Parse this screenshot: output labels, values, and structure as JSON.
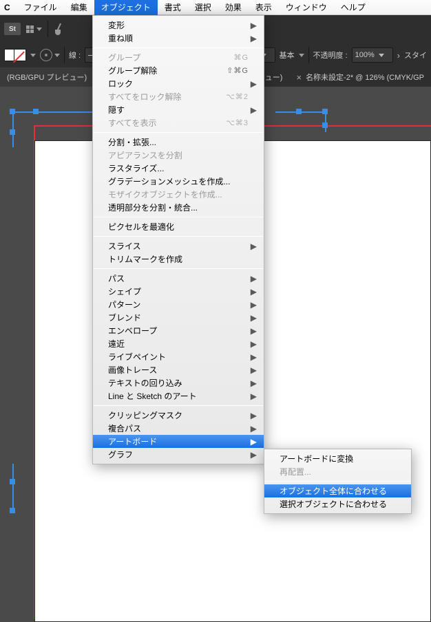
{
  "menubar": {
    "app": "C",
    "items": [
      "ファイル",
      "編集",
      "オブジェクト",
      "書式",
      "選択",
      "効果",
      "表示",
      "ウィンドウ",
      "ヘルプ"
    ],
    "active_index": 2
  },
  "toolbar": {
    "st_label": "St"
  },
  "propbar": {
    "stroke_label": "線 :",
    "basic_label": "基本",
    "opacity_label": "不透明度 :",
    "opacity_value": "100%",
    "style_label": "スタイ"
  },
  "tabs": {
    "t1": "(RGB/GPU プレビュー)",
    "t2_suffix": "ュー)",
    "t3": "名称未設定-2* @ 126% (CMYK/GP"
  },
  "menu": {
    "g1": [
      {
        "label": "変形",
        "sub": true
      },
      {
        "label": "重ね順",
        "sub": true
      }
    ],
    "g2": [
      {
        "label": "グループ",
        "sc": "⌘G",
        "disabled": true
      },
      {
        "label": "グループ解除",
        "sc": "⇧⌘G"
      },
      {
        "label": "ロック",
        "sub": true
      },
      {
        "label": "すべてをロック解除",
        "sc": "⌥⌘2",
        "disabled": true
      },
      {
        "label": "隠す",
        "sub": true
      },
      {
        "label": "すべてを表示",
        "sc": "⌥⌘3",
        "disabled": true
      }
    ],
    "g3": [
      {
        "label": "分割・拡張..."
      },
      {
        "label": "アピアランスを分割",
        "disabled": true
      },
      {
        "label": "ラスタライズ..."
      },
      {
        "label": "グラデーションメッシュを作成..."
      },
      {
        "label": "モザイクオブジェクトを作成...",
        "disabled": true
      },
      {
        "label": "透明部分を分割・統合..."
      }
    ],
    "g4": [
      {
        "label": "ピクセルを最適化"
      }
    ],
    "g5": [
      {
        "label": "スライス",
        "sub": true
      },
      {
        "label": "トリムマークを作成"
      }
    ],
    "g6": [
      {
        "label": "パス",
        "sub": true
      },
      {
        "label": "シェイプ",
        "sub": true
      },
      {
        "label": "パターン",
        "sub": true
      },
      {
        "label": "ブレンド",
        "sub": true
      },
      {
        "label": "エンベロープ",
        "sub": true
      },
      {
        "label": "遠近",
        "sub": true
      },
      {
        "label": "ライブペイント",
        "sub": true
      },
      {
        "label": "画像トレース",
        "sub": true
      },
      {
        "label": "テキストの回り込み",
        "sub": true
      },
      {
        "label": "Line と Sketch のアート",
        "sub": true
      }
    ],
    "g7": [
      {
        "label": "クリッピングマスク",
        "sub": true
      },
      {
        "label": "複合パス",
        "sub": true
      },
      {
        "label": "アートボード",
        "sub": true,
        "hl": true
      },
      {
        "label": "グラフ",
        "sub": true
      }
    ]
  },
  "submenu": {
    "items": [
      {
        "label": "アートボードに変換"
      },
      {
        "label": "再配置...",
        "disabled": true,
        "sep_after": true
      },
      {
        "label": "オブジェクト全体に合わせる",
        "hl": true
      },
      {
        "label": "選択オブジェクトに合わせる"
      }
    ]
  }
}
